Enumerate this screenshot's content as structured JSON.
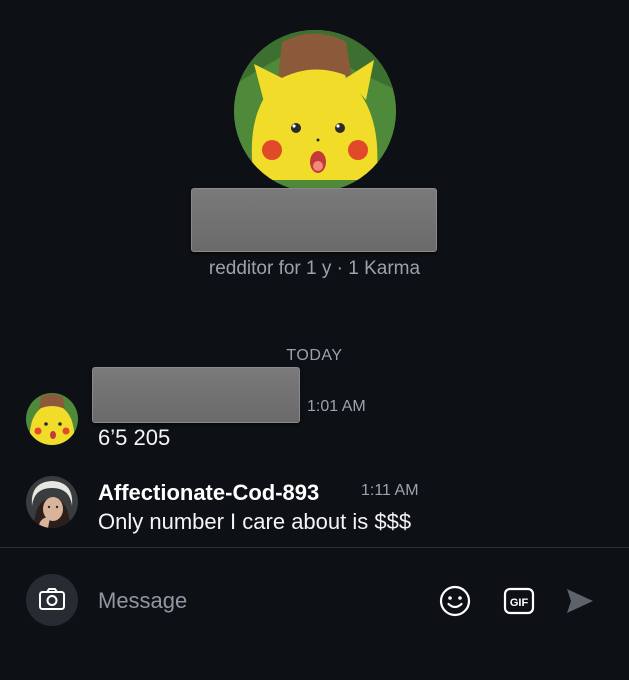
{
  "profile": {
    "avatar_icon": "surprised-pikachu-avatar",
    "meta": "redditor for 1 y · 1 Karma"
  },
  "date_divider": "TODAY",
  "messages": [
    {
      "avatar_icon": "surprised-pikachu-avatar",
      "time": "1:01 AM",
      "text": "6’5 205"
    },
    {
      "avatar_icon": "user-photo-avatar",
      "username": "Affectionate-Cod-893",
      "time": "1:11 AM",
      "text": "Only number I care about is $$$"
    }
  ],
  "composer": {
    "placeholder": "Message",
    "camera_icon": "camera-icon",
    "emoji_icon": "smiley-icon",
    "gif_icon": "gif-icon",
    "send_icon": "send-icon"
  },
  "colors": {
    "background": "#0d1014",
    "secondary_text": "#9aa3ad",
    "redaction": "#737373"
  }
}
